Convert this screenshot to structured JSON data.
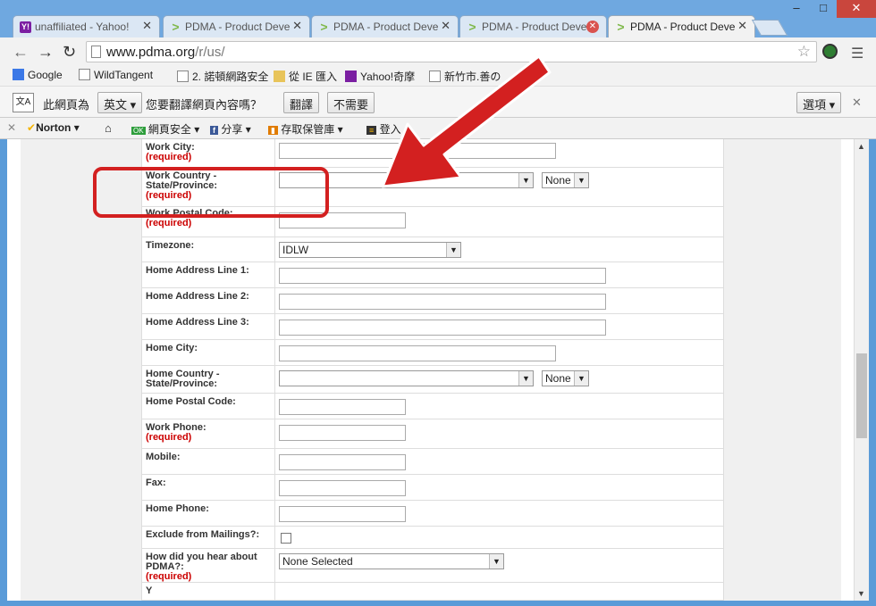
{
  "tabs": [
    {
      "title": "unaffiliated - Yahoo!",
      "icon": "yahoo-icon"
    },
    {
      "title": "PDMA - Product Deve",
      "icon": "pdma-icon"
    },
    {
      "title": "PDMA - Product Deve",
      "icon": "pdma-icon"
    },
    {
      "title": "PDMA - Product Deve",
      "icon": "pdma-icon"
    },
    {
      "title": "PDMA - Product Deve",
      "icon": "pdma-icon"
    }
  ],
  "window": {
    "minimize": "–",
    "maximize": "□",
    "close": "✕"
  },
  "address": {
    "host": "www.pdma.org",
    "path": "/r/us/"
  },
  "bookmarks": [
    "Google",
    "WildTangent",
    "2. 諾頓網路安全",
    "從 IE 匯入",
    "Yahoo!奇摩",
    "新竹市.善の"
  ],
  "translate": {
    "prefix": "此網頁為",
    "language": "英文",
    "question": "您要翻譯網頁內容嗎？",
    "translate_btn": "翻譯",
    "no_btn": "不需要",
    "options_btn": "選項"
  },
  "norton_bar": {
    "norton": "Norton",
    "safe_web": "網頁安全",
    "share": "分享",
    "vault": "存取保管庫",
    "login": "登入"
  },
  "form": {
    "required_text": "(required)",
    "work_city": "Work City:",
    "work_country": "Work Country - State/Province:",
    "work_country_sub": "None",
    "work_postal": "Work Postal Code:",
    "timezone": "Timezone:",
    "timezone_value": "IDLW",
    "home_addr1": "Home Address Line 1:",
    "home_addr2": "Home Address Line 2:",
    "home_addr3": "Home Address Line 3:",
    "home_city": "Home City:",
    "home_country": "Home Country - State/Province:",
    "home_country_sub": "None",
    "home_postal": "Home Postal Code:",
    "work_phone": "Work Phone:",
    "mobile": "Mobile:",
    "fax": "Fax:",
    "home_phone": "Home Phone:",
    "exclude_mailings": "Exclude from Mailings?:",
    "heard_about": "How did you hear about PDMA?:",
    "heard_value": "None Selected",
    "partial": "Y"
  },
  "colors": {
    "annotation": "#d32020",
    "required": "#cc0000"
  }
}
